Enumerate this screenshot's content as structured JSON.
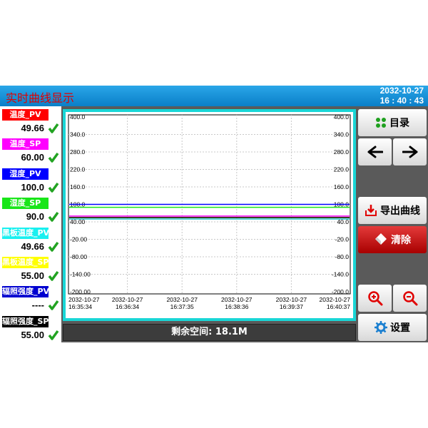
{
  "header": {
    "title": "实时曲线显示",
    "date": "2032-10-27",
    "time": "16 : 40 : 43"
  },
  "params": [
    {
      "label": "温度_PV",
      "value": "49.66",
      "color": "#ff0000"
    },
    {
      "label": "温度_SP",
      "value": "60.00",
      "color": "#ff00ff"
    },
    {
      "label": "湿度_PV",
      "value": "100.0",
      "color": "#0000ff"
    },
    {
      "label": "湿度_SP",
      "value": "90.0",
      "color": "#19e619"
    },
    {
      "label": "黑板温度_PV",
      "value": "49.66",
      "color": "#19f0f0"
    },
    {
      "label": "黑板温度_SP",
      "value": "55.00",
      "color": "#ffff00"
    },
    {
      "label": "辐照强度_PV",
      "value": "----",
      "color": "#0000d0"
    },
    {
      "label": "辐照强度_SP",
      "value": "55.00",
      "color": "#000000"
    }
  ],
  "status": {
    "label": "剩余空间: 18.1M"
  },
  "buttons": {
    "catalog": "目录",
    "export": "导出曲线",
    "clear": "清除",
    "settings": "设置"
  },
  "chart_data": {
    "type": "line",
    "ylim": [
      -200,
      400
    ],
    "y_ticks": [
      "400.0",
      "340.0",
      "280.0",
      "220.0",
      "160.0",
      "100.0",
      "40.00",
      "-20.00",
      "-80.00",
      "-140.00",
      "-200.00"
    ],
    "y_ticks_right": [
      "400.0",
      "340.0",
      "280.0",
      "220.0",
      "160.0",
      "100.0",
      "40.0",
      "-20.0",
      "-80.0",
      "-140.0",
      "-200.0"
    ],
    "x_ticks": [
      {
        "date": "2032-10-27",
        "time": "16:35:34"
      },
      {
        "date": "2032-10-27",
        "time": "16:36:34"
      },
      {
        "date": "2032-10-27",
        "time": "16:37:35"
      },
      {
        "date": "2032-10-27",
        "time": "16:38:36"
      },
      {
        "date": "2032-10-27",
        "time": "16:39:37"
      },
      {
        "date": "2032-10-27",
        "time": "16:40:37"
      }
    ],
    "series": [
      {
        "name": "湿度_PV",
        "color": "#0000ff",
        "y": 100
      },
      {
        "name": "湿度_SP",
        "color": "#19e619",
        "y": 90
      },
      {
        "name": "温度_SP",
        "color": "#ff00ff",
        "y": 60
      },
      {
        "name": "黑板温度_SP",
        "color": "#ffff00",
        "y": 55
      },
      {
        "name": "辐照强度_SP",
        "color": "#000000",
        "y": 55
      },
      {
        "name": "温度_PV",
        "color": "#ff0000",
        "y": 49.66
      },
      {
        "name": "黑板温度_PV",
        "color": "#19f0f0",
        "y": 49.66
      }
    ]
  }
}
